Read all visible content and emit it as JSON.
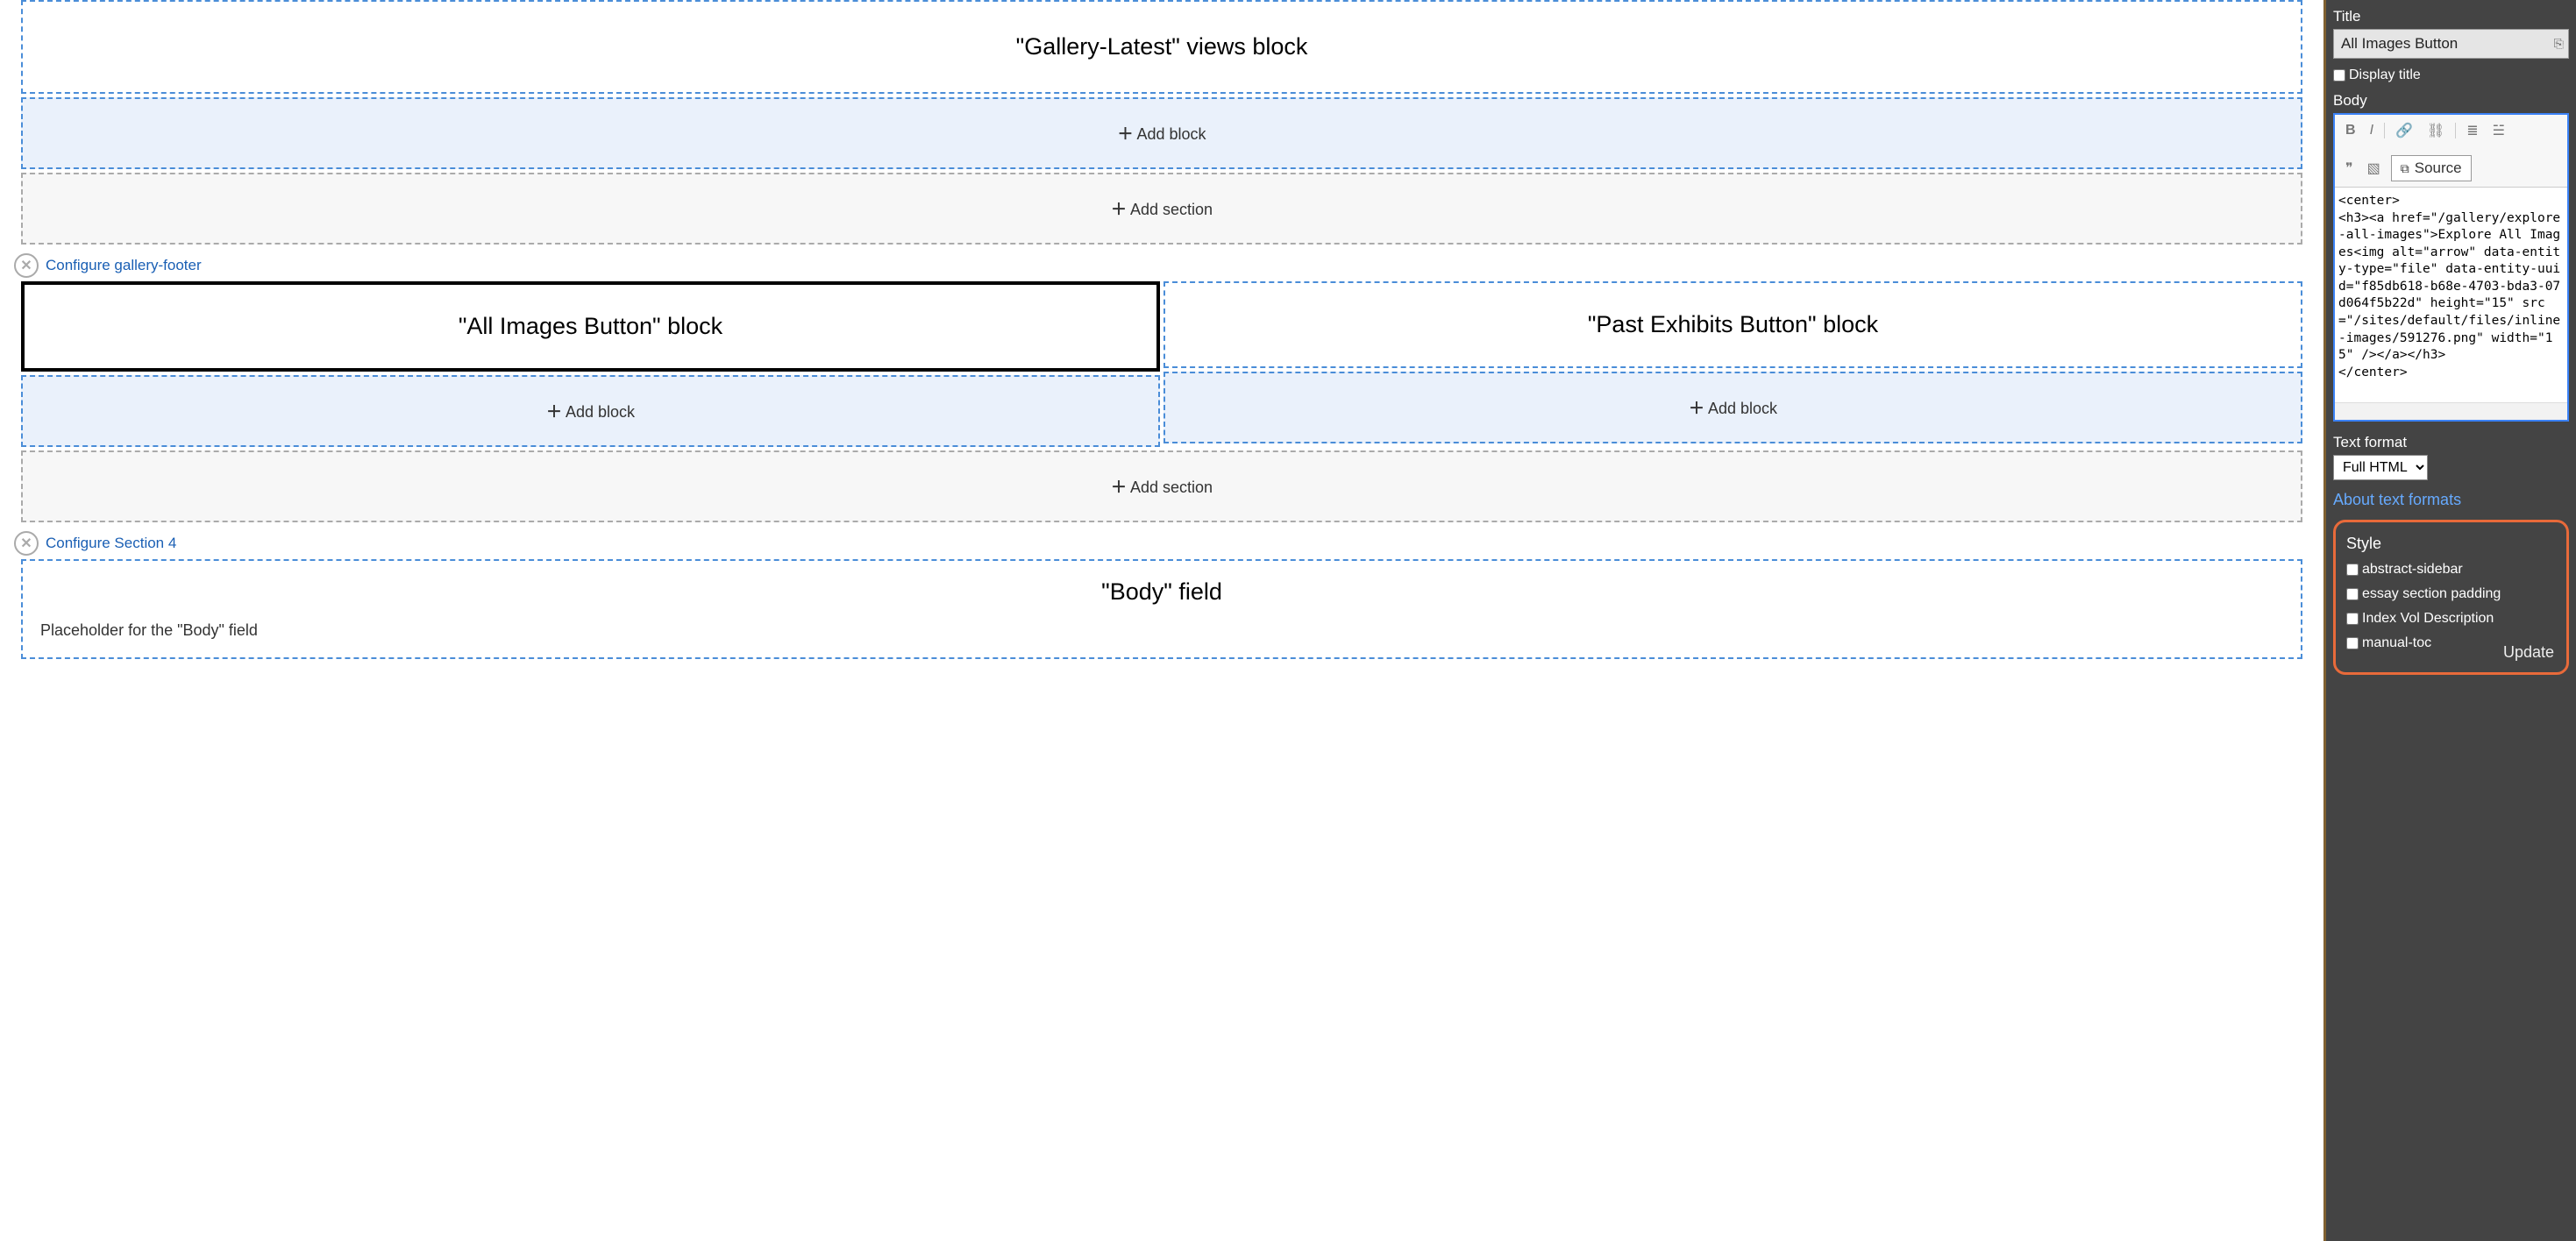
{
  "main": {
    "block1": "\"Gallery-Latest\" views block",
    "add_block": "Add block",
    "add_section": "Add section",
    "configure_footer": "Configure gallery-footer",
    "block_all_images": "\"All Images Button\" block",
    "block_past_exhibits": "\"Past Exhibits Button\" block",
    "configure_section4": "Configure Section 4",
    "body_title": "\"Body\" field",
    "body_placeholder": "Placeholder for the \"Body\" field"
  },
  "sidebar": {
    "title_label": "Title",
    "title_value": "All Images Button",
    "display_title": "Display title",
    "body_label": "Body",
    "source_label": "Source",
    "editor_content": "<center>\n<h3><a href=\"/gallery/explore-all-images\">Explore All Images<img alt=\"arrow\" data-entity-type=\"file\" data-entity-uuid=\"f85db618-b68e-4703-bda3-07d064f5b22d\" height=\"15\" src=\"/sites/default/files/inline-images/591276.png\" width=\"15\" /></a></h3>\n</center>",
    "format_label": "Text format",
    "format_value": "Full HTML",
    "about_link": "About text formats",
    "style_label": "Style",
    "style_opts": [
      "abstract-sidebar",
      "essay section padding",
      "Index Vol Description",
      "manual-toc"
    ],
    "update": "Update"
  }
}
